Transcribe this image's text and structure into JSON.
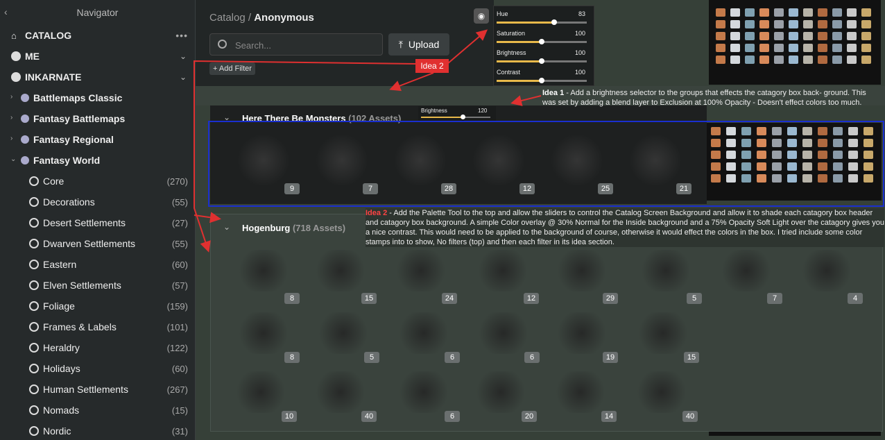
{
  "sidebar": {
    "title": "Navigator",
    "catalog": "CATALOG",
    "me": "ME",
    "inkarnate": "INKARNATE",
    "packs": [
      "Battlemaps Classic",
      "Fantasy Battlemaps",
      "Fantasy Regional",
      "Fantasy World"
    ],
    "items": [
      {
        "label": "Core",
        "count": "(270)"
      },
      {
        "label": "Decorations",
        "count": "(55)"
      },
      {
        "label": "Desert Settlements",
        "count": "(27)"
      },
      {
        "label": "Dwarven Settlements",
        "count": "(55)"
      },
      {
        "label": "Eastern",
        "count": "(60)"
      },
      {
        "label": "Elven Settlements",
        "count": "(57)"
      },
      {
        "label": "Foliage",
        "count": "(159)"
      },
      {
        "label": "Frames & Labels",
        "count": "(101)"
      },
      {
        "label": "Heraldry",
        "count": "(122)"
      },
      {
        "label": "Holidays",
        "count": "(60)"
      },
      {
        "label": "Human Settlements",
        "count": "(267)"
      },
      {
        "label": "Nomads",
        "count": "(15)"
      },
      {
        "label": "Nordic",
        "count": "(31)"
      }
    ]
  },
  "header": {
    "crumb_root": "Catalog",
    "crumb_sep": "/",
    "crumb_current": "Anonymous",
    "search_placeholder": "Search...",
    "upload": "Upload",
    "add_filter": "+ Add Filter"
  },
  "palette": {
    "sliders": [
      {
        "label": "Hue",
        "value": "83",
        "level": 0.64
      },
      {
        "label": "Saturation",
        "value": "100",
        "level": 0.5
      },
      {
        "label": "Brightness",
        "value": "100",
        "level": 0.5
      },
      {
        "label": "Contrast",
        "value": "100",
        "level": 0.5
      }
    ]
  },
  "idea1": {
    "tag": "Idea 1",
    "text": " - Add a brightness selector to the groups that effects the catagory box back- ground.  This was set by adding a blend layer to Exclusion at 100% Opacity - Doesn't effect colors too much."
  },
  "idea2": {
    "label": "Idea 2",
    "tag": "Idea 2",
    "text": " - Add the Palette Tool to the top and allow the sliders to control the Catalog Screen Background and allow it to shade each catagory box header and catagory box background.  A simple Color overlay @ 30%  Normal for the Inside background and a 75% Opacity Soft Light over the catagory gives you a nice contrast. This would need to be applied to the background of course, otherwise it would effect the colors in the box.  I tried include some color stamps into to show, No filters (top) and then each filter in its idea section."
  },
  "group1": {
    "title": "Here There Be Monsters",
    "count": "(102 Assets)",
    "brightness_label": "Brightness",
    "brightness_value": "120",
    "brightness_level": 0.6,
    "assets": [
      "9",
      "7",
      "28",
      "12",
      "25",
      "21"
    ]
  },
  "group2": {
    "title": "Hogenburg",
    "count": "(718 Assets)",
    "row1": [
      "8",
      "15",
      "24",
      "12",
      "29",
      "5",
      "7",
      "4"
    ],
    "row2": [
      "8",
      "5",
      "6",
      "6",
      "19",
      "15"
    ],
    "row3": [
      "10",
      "40",
      "6",
      "20",
      "14",
      "40"
    ]
  },
  "colors": {
    "accent": "#e03030",
    "highlight": "#1a2fd0",
    "slider": "#e8b94a"
  }
}
